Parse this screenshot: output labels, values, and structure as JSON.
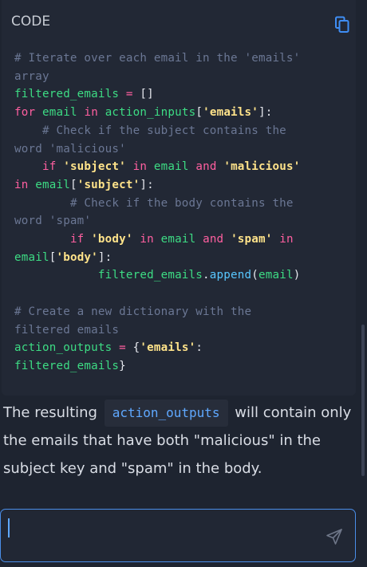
{
  "code_card": {
    "header": "CODE",
    "copy_icon": "copy-icon",
    "lines": [
      [
        {
          "c": "comment",
          "t": "# Iterate over each email in the 'emails'"
        }
      ],
      [
        {
          "c": "comment",
          "t": "array"
        }
      ],
      [
        {
          "c": "var",
          "t": "filtered_emails"
        },
        {
          "c": "punc",
          "t": " "
        },
        {
          "c": "kw",
          "t": "="
        },
        {
          "c": "punc",
          "t": " []"
        }
      ],
      [
        {
          "c": "kw",
          "t": "for"
        },
        {
          "c": "punc",
          "t": " "
        },
        {
          "c": "var",
          "t": "email"
        },
        {
          "c": "punc",
          "t": " "
        },
        {
          "c": "kw",
          "t": "in"
        },
        {
          "c": "punc",
          "t": " "
        },
        {
          "c": "var",
          "t": "action_inputs"
        },
        {
          "c": "punc",
          "t": "["
        },
        {
          "c": "str",
          "t": "'emails'"
        },
        {
          "c": "punc",
          "t": "]:"
        }
      ],
      [
        {
          "c": "punc",
          "t": "    "
        },
        {
          "c": "comment",
          "t": "# Check if the subject contains the"
        }
      ],
      [
        {
          "c": "comment",
          "t": "word 'malicious'"
        }
      ],
      [
        {
          "c": "punc",
          "t": "    "
        },
        {
          "c": "kw",
          "t": "if"
        },
        {
          "c": "punc",
          "t": " "
        },
        {
          "c": "str",
          "t": "'subject'"
        },
        {
          "c": "punc",
          "t": " "
        },
        {
          "c": "kw",
          "t": "in"
        },
        {
          "c": "punc",
          "t": " "
        },
        {
          "c": "var",
          "t": "email"
        },
        {
          "c": "punc",
          "t": " "
        },
        {
          "c": "kw",
          "t": "and"
        },
        {
          "c": "punc",
          "t": " "
        },
        {
          "c": "str",
          "t": "'malicious'"
        }
      ],
      [
        {
          "c": "kw",
          "t": "in"
        },
        {
          "c": "punc",
          "t": " "
        },
        {
          "c": "var",
          "t": "email"
        },
        {
          "c": "punc",
          "t": "["
        },
        {
          "c": "str",
          "t": "'subject'"
        },
        {
          "c": "punc",
          "t": "]:"
        }
      ],
      [
        {
          "c": "punc",
          "t": "        "
        },
        {
          "c": "comment",
          "t": "# Check if the body contains the"
        }
      ],
      [
        {
          "c": "comment",
          "t": "word 'spam'"
        }
      ],
      [
        {
          "c": "punc",
          "t": "        "
        },
        {
          "c": "kw",
          "t": "if"
        },
        {
          "c": "punc",
          "t": " "
        },
        {
          "c": "str",
          "t": "'body'"
        },
        {
          "c": "punc",
          "t": " "
        },
        {
          "c": "kw",
          "t": "in"
        },
        {
          "c": "punc",
          "t": " "
        },
        {
          "c": "var",
          "t": "email"
        },
        {
          "c": "punc",
          "t": " "
        },
        {
          "c": "kw",
          "t": "and"
        },
        {
          "c": "punc",
          "t": " "
        },
        {
          "c": "str",
          "t": "'spam'"
        },
        {
          "c": "punc",
          "t": " "
        },
        {
          "c": "kw",
          "t": "in"
        }
      ],
      [
        {
          "c": "var",
          "t": "email"
        },
        {
          "c": "punc",
          "t": "["
        },
        {
          "c": "str",
          "t": "'body'"
        },
        {
          "c": "punc",
          "t": "]:"
        }
      ],
      [
        {
          "c": "punc",
          "t": "            "
        },
        {
          "c": "var",
          "t": "filtered_emails"
        },
        {
          "c": "punc",
          "t": "."
        },
        {
          "c": "fn",
          "t": "append"
        },
        {
          "c": "punc",
          "t": "("
        },
        {
          "c": "var",
          "t": "email"
        },
        {
          "c": "punc",
          "t": ")"
        }
      ],
      [
        {
          "c": "punc",
          "t": ""
        }
      ],
      [
        {
          "c": "comment",
          "t": "# Create a new dictionary with the"
        }
      ],
      [
        {
          "c": "comment",
          "t": "filtered emails"
        }
      ],
      [
        {
          "c": "var",
          "t": "action_outputs"
        },
        {
          "c": "punc",
          "t": " "
        },
        {
          "c": "kw",
          "t": "="
        },
        {
          "c": "punc",
          "t": " {"
        },
        {
          "c": "str",
          "t": "'emails'"
        },
        {
          "c": "punc",
          "t": ":"
        }
      ],
      [
        {
          "c": "var",
          "t": "filtered_emails"
        },
        {
          "c": "punc",
          "t": "}"
        }
      ]
    ]
  },
  "explanation": {
    "before": "The resulting ",
    "code": "action_outputs",
    "after": " will contain only the emails that have both \"malicious\" in the subject key and \"spam\" in the body."
  },
  "composer": {
    "value": "",
    "placeholder": "",
    "send_icon": "send-icon"
  },
  "colors": {
    "accent": "#4a8ee8",
    "comment": "#6b7794",
    "keyword": "#ff5fa0",
    "identifier": "#3ddc84",
    "string": "#ffe38a",
    "function": "#58c7ff"
  }
}
